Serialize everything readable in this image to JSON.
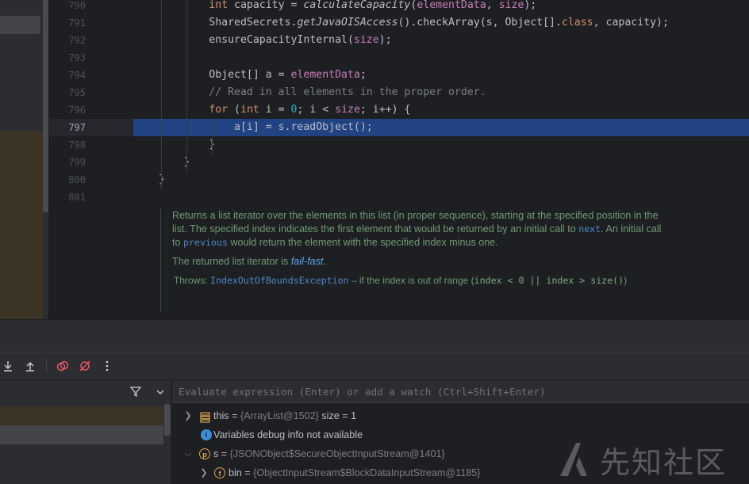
{
  "editor": {
    "lines": [
      {
        "num": "790",
        "segments": [
          {
            "t": "            "
          },
          {
            "t": "int",
            "c": "kw"
          },
          {
            "t": " capacity = "
          },
          {
            "t": "calculateCapacity",
            "c": "itl"
          },
          {
            "t": "("
          },
          {
            "t": "elementData",
            "c": "fld"
          },
          {
            "t": ", "
          },
          {
            "t": "size",
            "c": "fld"
          },
          {
            "t": ");"
          }
        ]
      },
      {
        "num": "791",
        "segments": [
          {
            "t": "            SharedSecrets."
          },
          {
            "t": "getJavaOISAccess",
            "c": "itl"
          },
          {
            "t": "().checkArray(s, Object[]."
          },
          {
            "t": "class",
            "c": "kw"
          },
          {
            "t": ", capacity);"
          }
        ]
      },
      {
        "num": "792",
        "segments": [
          {
            "t": "            ensureCapacityInternal("
          },
          {
            "t": "size",
            "c": "fld"
          },
          {
            "t": ");"
          }
        ]
      },
      {
        "num": "793",
        "segments": []
      },
      {
        "num": "794",
        "segments": [
          {
            "t": "            Object[] a = "
          },
          {
            "t": "elementData",
            "c": "fld"
          },
          {
            "t": ";"
          }
        ]
      },
      {
        "num": "795",
        "segments": [
          {
            "t": "            "
          },
          {
            "t": "// Read in all elements in the proper order.",
            "c": "cmt"
          }
        ]
      },
      {
        "num": "796",
        "segments": [
          {
            "t": "            "
          },
          {
            "t": "for",
            "c": "kw"
          },
          {
            "t": " ("
          },
          {
            "t": "int",
            "c": "kw"
          },
          {
            "t": " i = "
          },
          {
            "t": "0",
            "c": "num"
          },
          {
            "t": "; i < "
          },
          {
            "t": "size",
            "c": "fld"
          },
          {
            "t": "; i++) {"
          }
        ]
      },
      {
        "num": "797",
        "segments": [
          {
            "t": "                a[i] = s.readObject();"
          }
        ]
      },
      {
        "num": "798",
        "segments": [
          {
            "t": "            }"
          }
        ]
      },
      {
        "num": "799",
        "segments": [
          {
            "t": "        }"
          }
        ]
      },
      {
        "num": "800",
        "segments": [
          {
            "t": "    }"
          }
        ]
      },
      {
        "num": "801",
        "segments": []
      }
    ],
    "current_line": "797",
    "doc": {
      "p1_a": "Returns a list iterator over the elements in this list (in proper sequence), starting at the specified position in the list. The specified index indicates the first element that would be returned by an initial call to ",
      "p1_link1": "next",
      "p1_b": ". An initial call to ",
      "p1_link2": "previous",
      "p1_c": " would return the element with the specified index minus one.",
      "p2_a": "The returned list iterator is ",
      "p2_em": "fail-fast",
      "p2_b": ".",
      "throws_label": "Throws:",
      "throws_link": "IndexOutOfBoundsException",
      "throws_text": " – if the index is out of range (",
      "throws_code": "index < 0 || index > size()",
      "throws_end": ")"
    }
  },
  "debugger": {
    "eval_placeholder": "Evaluate expression (Enter) or add a watch (Ctrl+Shift+Enter)",
    "variables": [
      {
        "name": "this",
        "eq": " = ",
        "value": "{ArrayList@1502}",
        "extra": "  size = 1",
        "icon": "list-icon",
        "expanded": false
      },
      {
        "name": "Variables debug info not available",
        "icon": "info-icon",
        "expanded": null
      },
      {
        "name": "s",
        "eq": " = ",
        "value": "{JSONObject$SecureObjectInputStream@1401}",
        "icon": "parameter-icon",
        "badge": "p",
        "expanded": true
      },
      {
        "name": "bin",
        "eq": " = ",
        "value": "{ObjectInputStream$BlockDataInputStream@1185}",
        "icon": "field-icon",
        "badge": "f",
        "expanded": false
      }
    ]
  },
  "watermark": {
    "text": "先知社区"
  },
  "colors": {
    "accent": "#214283",
    "bg": "#1e1f22",
    "panel": "#2b2d30"
  }
}
